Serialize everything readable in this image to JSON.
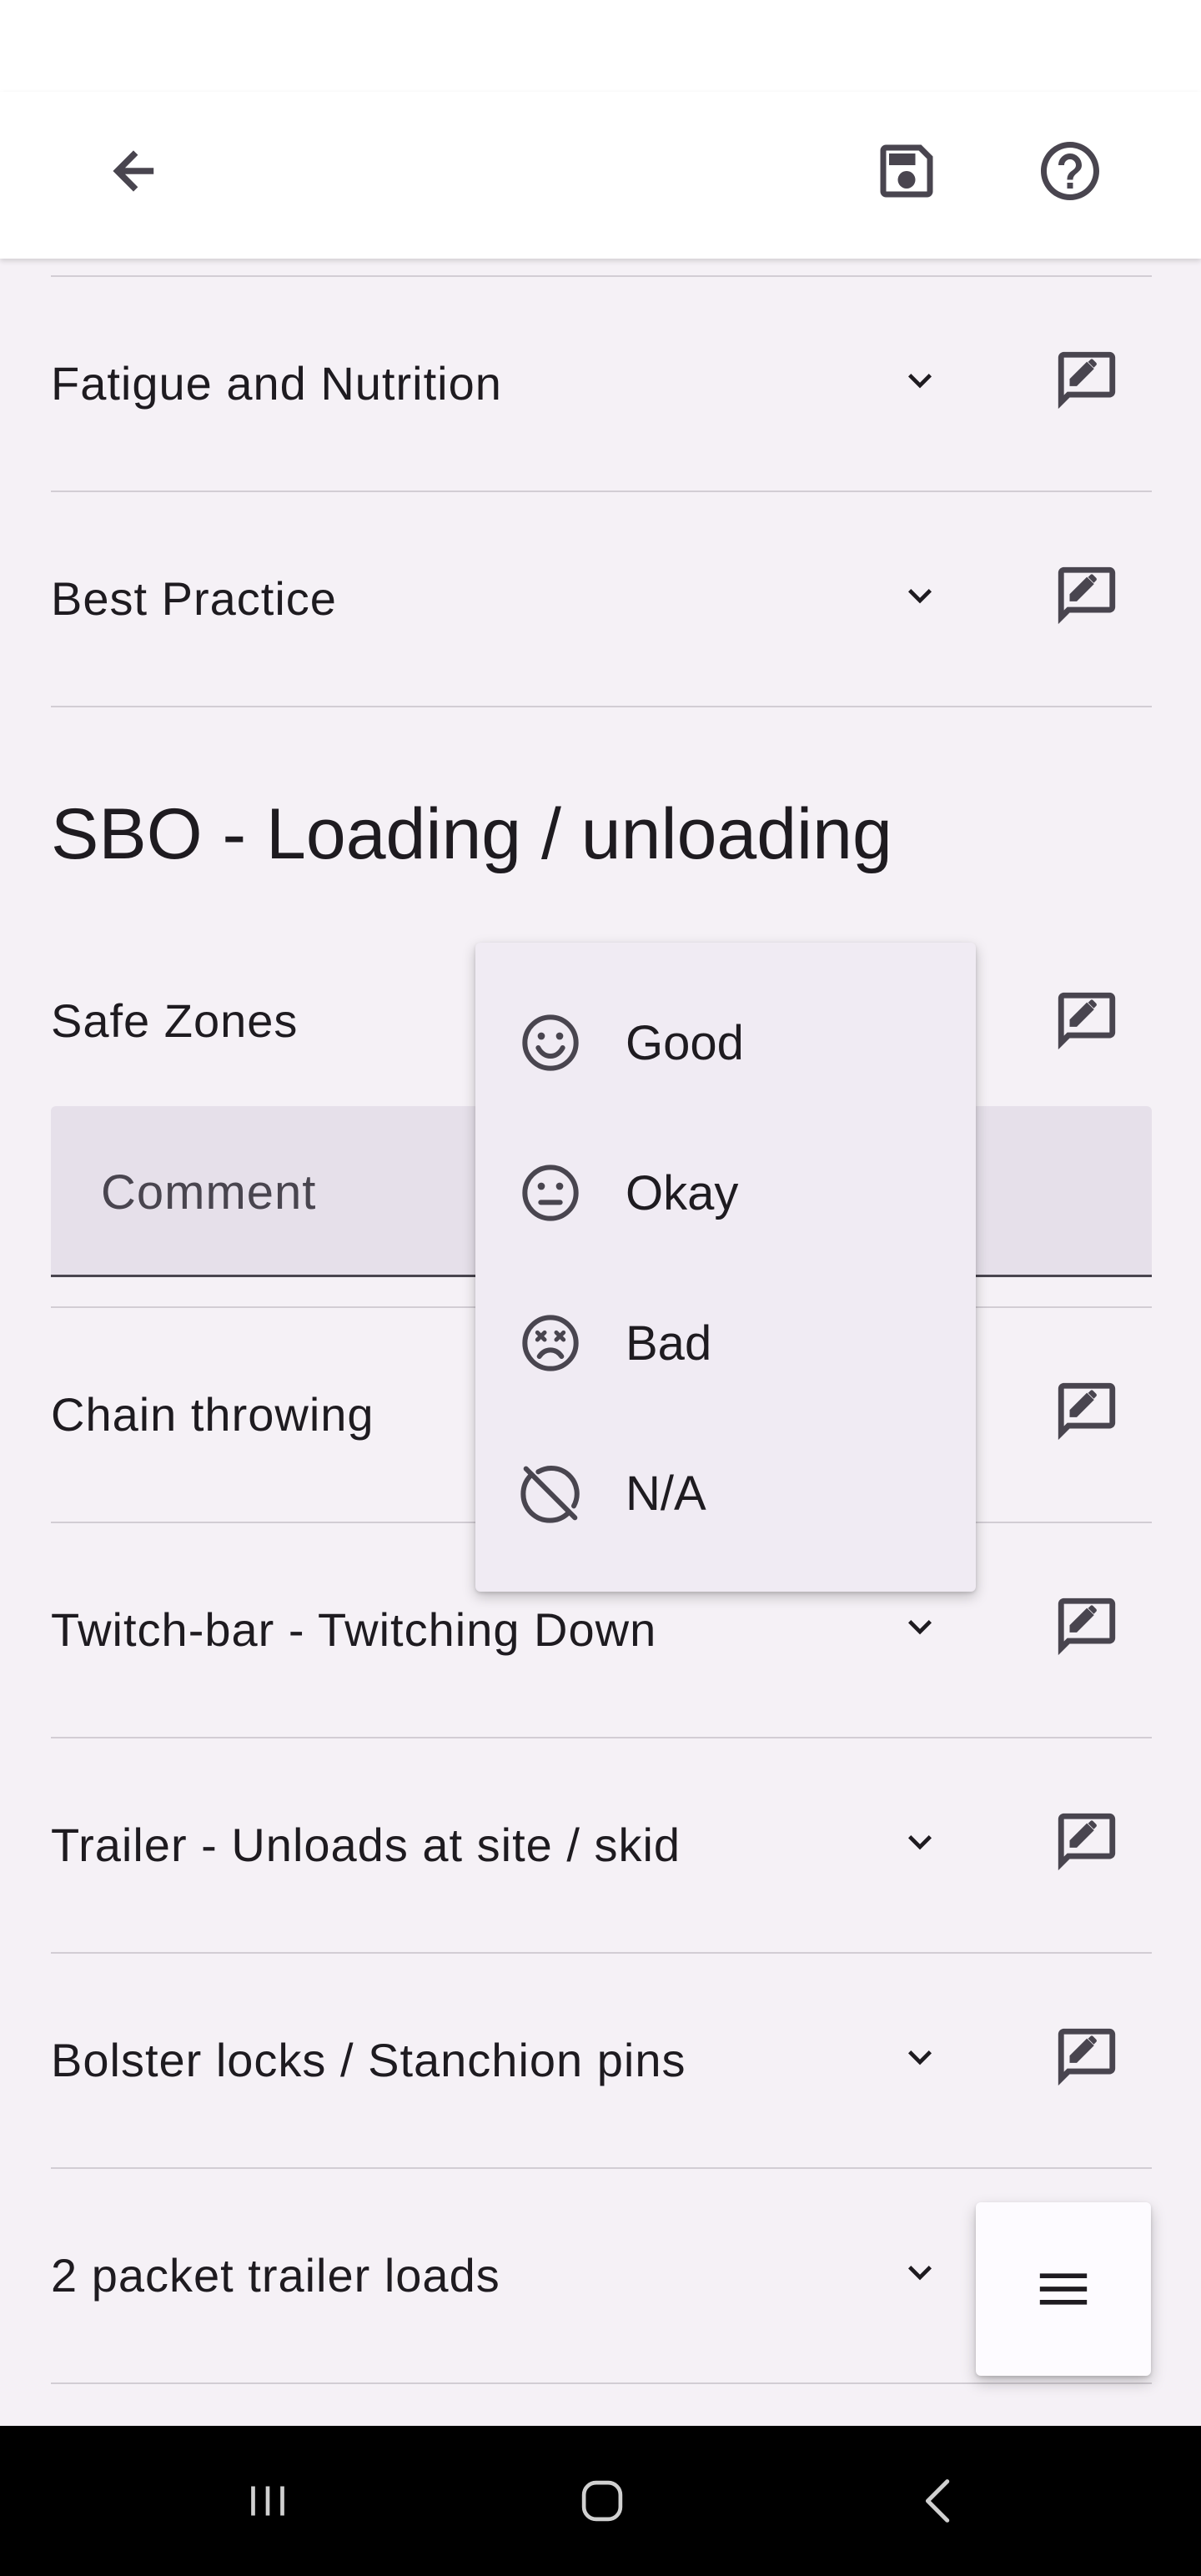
{
  "section": {
    "title": "SBO - Loading / unloading"
  },
  "rows": [
    {
      "label": "Fatigue and Nutrition"
    },
    {
      "label": "Best Practice"
    },
    {
      "label": "Safe Zones"
    },
    {
      "label": "Chain throwing"
    },
    {
      "label": "Twitch-bar - Twitching Down"
    },
    {
      "label": "Trailer - Unloads at site / skid"
    },
    {
      "label": "Bolster locks / Stanchion pins"
    },
    {
      "label": "2 packet trailer loads"
    }
  ],
  "comment": {
    "label": "Comment"
  },
  "rating_menu": {
    "items": [
      {
        "label": "Good",
        "icon": "smile-icon"
      },
      {
        "label": "Okay",
        "icon": "neutral-face-icon"
      },
      {
        "label": "Bad",
        "icon": "dizzy-face-icon"
      },
      {
        "label": "N/A",
        "icon": "not-applicable-icon"
      }
    ]
  },
  "icons": {
    "back": "arrow-back-icon",
    "save": "save-icon",
    "help": "help-icon",
    "expand": "chevron-down-icon",
    "comment": "rate-review-icon",
    "fab": "menu-icon"
  },
  "colors": {
    "background": "#f5f1f6",
    "app_bar": "#ffffff",
    "icon": "#49454f",
    "divider": "#d2cdd4",
    "comment_field": "#e6e0ea",
    "menu_surface": "#f0ebf3"
  }
}
